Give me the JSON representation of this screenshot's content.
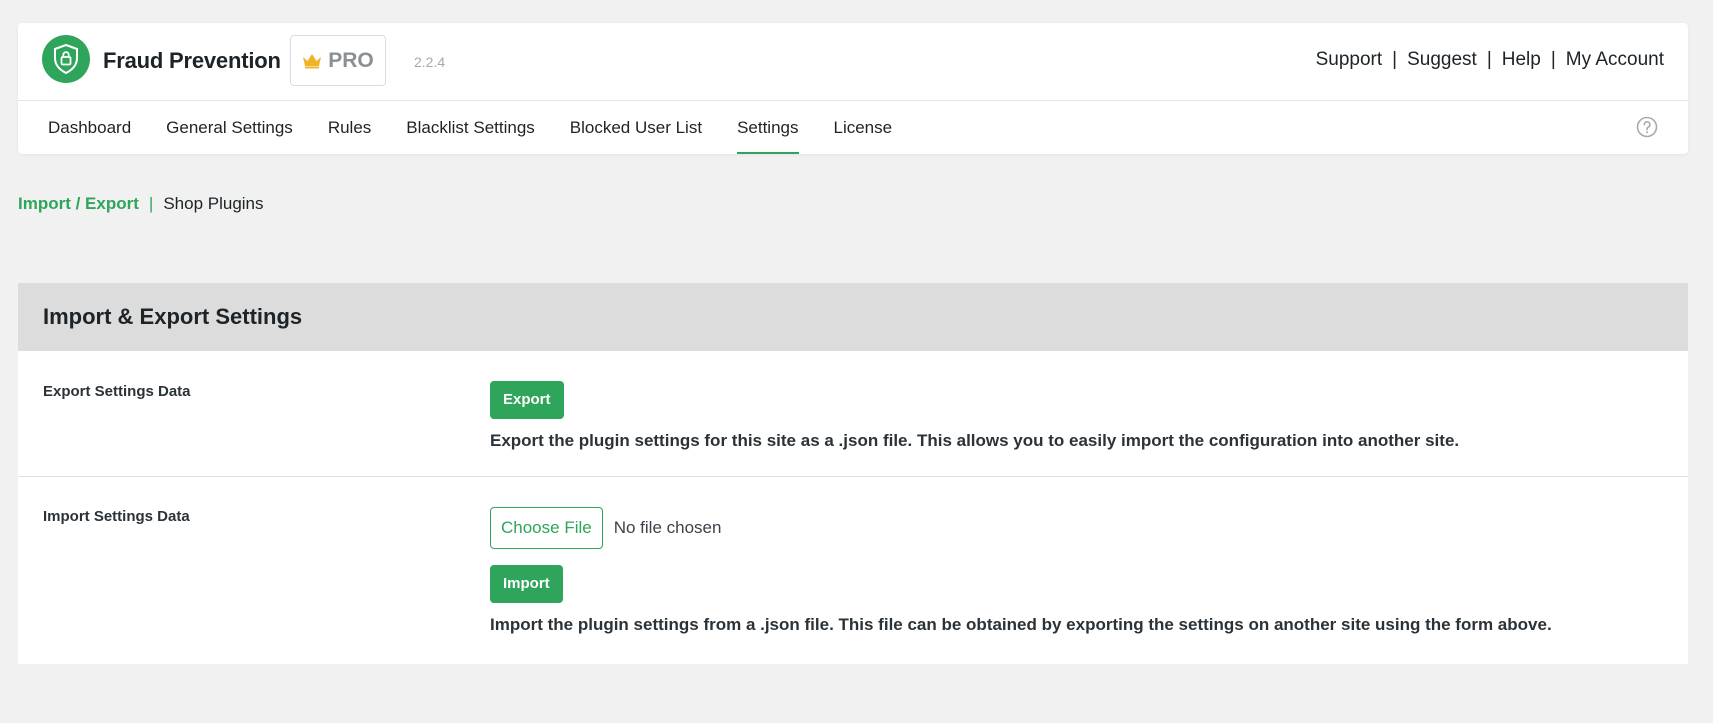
{
  "brand": {
    "title": "Fraud Prevention",
    "pro_label": "PRO",
    "version": "2.2.4",
    "accent_color": "#2ea55b"
  },
  "top_links": [
    {
      "label": "Support"
    },
    {
      "label": "Suggest"
    },
    {
      "label": "Help"
    },
    {
      "label": "My Account"
    }
  ],
  "top_links_separator": "|",
  "nav": {
    "tabs": [
      {
        "label": "Dashboard"
      },
      {
        "label": "General Settings"
      },
      {
        "label": "Rules"
      },
      {
        "label": "Blacklist Settings"
      },
      {
        "label": "Blocked User List"
      },
      {
        "label": "Settings",
        "active": true
      },
      {
        "label": "License"
      }
    ]
  },
  "subnav": {
    "active": "Import / Export",
    "separator": "|",
    "other": "Shop Plugins"
  },
  "panel": {
    "title": "Import & Export Settings",
    "export": {
      "label": "Export Settings Data",
      "button": "Export",
      "description": "Export the plugin settings for this site as a .json file. This allows you to easily import the configuration into another site."
    },
    "import": {
      "label": "Import Settings Data",
      "file_button": "Choose File",
      "file_status": "No file chosen",
      "button": "Import",
      "description": "Import the plugin settings from a .json file. This file can be obtained by exporting the settings on another site using the form above."
    }
  }
}
